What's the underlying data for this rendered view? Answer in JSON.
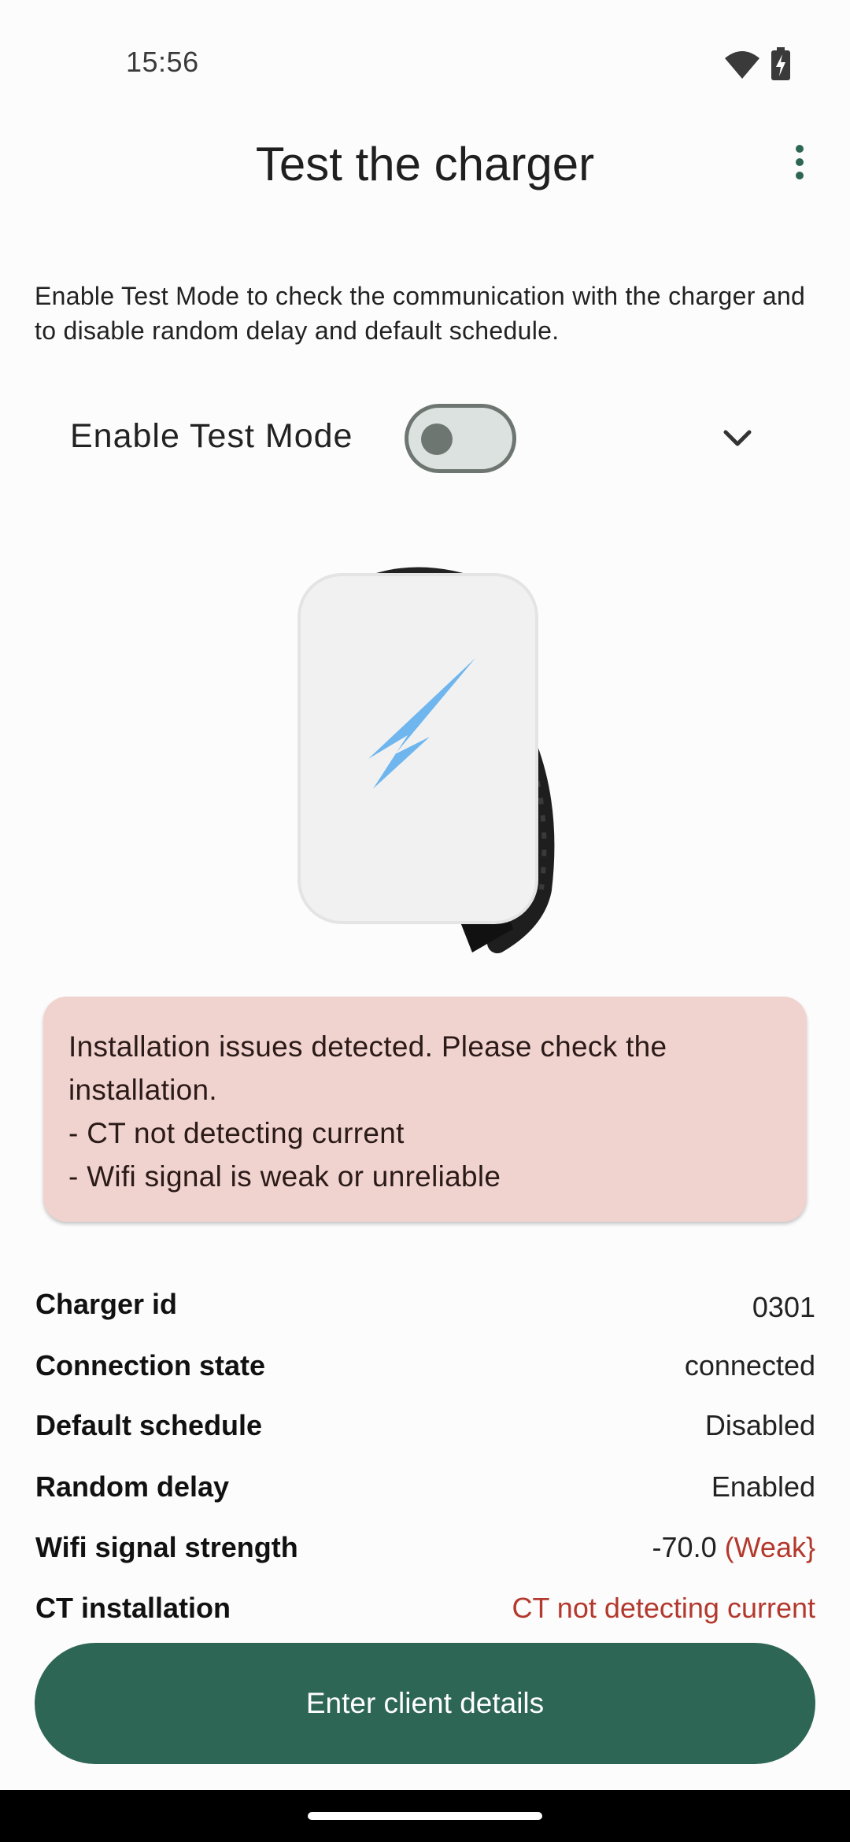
{
  "status_bar": {
    "time": "15:56",
    "wifi_icon": "wifi-icon",
    "battery_icon": "battery-charging-icon"
  },
  "app_bar": {
    "title": "Test the charger",
    "menu_icon": "more-vert-icon"
  },
  "description": "Enable Test Mode to check the communication with the charger and to disable random delay and default schedule.",
  "test_mode": {
    "label": "Enable Test Mode",
    "enabled": false,
    "expand_icon": "chevron-down-icon"
  },
  "alert": {
    "lines": [
      "Installation issues detected. Please check the",
      "installation.",
      "- CT not detecting current",
      "- Wifi signal is weak or unreliable"
    ],
    "background": "#F0D3CF"
  },
  "details": [
    {
      "label": "Charger id",
      "value": "0301"
    },
    {
      "label": "Connection state",
      "value": "connected"
    },
    {
      "label": "Default schedule",
      "value": "Disabled"
    },
    {
      "label": "Random delay",
      "value": "Enabled"
    },
    {
      "label": "Wifi signal strength",
      "value": "-70.0",
      "note": "(Weak}"
    },
    {
      "label": "CT installation",
      "value": "CT not detecting current"
    }
  ],
  "primary_button": {
    "label": "Enter client details",
    "color": "#2E6655"
  },
  "colors": {
    "accent": "#2E6655",
    "warning": "#B3392E"
  }
}
